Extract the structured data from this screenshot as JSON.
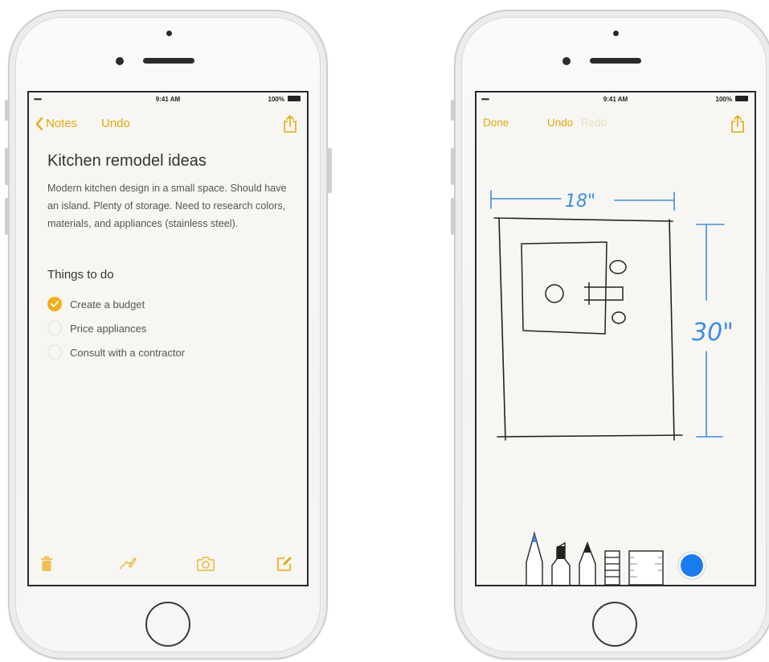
{
  "left_phone": {
    "status": {
      "signal": "•••••",
      "time": "9:41 AM",
      "battery": "100%"
    },
    "nav": {
      "back_label": "Notes",
      "undo_label": "Undo"
    },
    "note": {
      "title": "Kitchen remodel ideas",
      "body": "Modern kitchen design in a small space. Should have an island. Plenty of storage. Need to research colors, materials, and appliances (stainless steel).",
      "section_title": "Things to do",
      "checklist": [
        {
          "label": "Create a budget",
          "checked": true
        },
        {
          "label": "Price appliances",
          "checked": false
        },
        {
          "label": "Consult with a contractor",
          "checked": false
        }
      ]
    },
    "toolbar_icons": [
      "trash-icon",
      "sketch-icon",
      "camera-icon",
      "compose-icon"
    ]
  },
  "right_phone": {
    "status": {
      "signal": "•••••",
      "time": "9:41 AM",
      "battery": "100%"
    },
    "nav": {
      "done_label": "Done",
      "undo_label": "Undo",
      "redo_label": "Redo"
    },
    "sketch": {
      "width_label": "18\"",
      "height_label": "30\""
    },
    "tools": [
      "pen-tool-icon",
      "marker-tool-icon",
      "pencil-tool-icon",
      "eraser-tool-icon",
      "ruler-tool-icon",
      "color-picker-icon"
    ]
  },
  "colors": {
    "accent": "#e4a90c",
    "check_fill": "#f2ae14",
    "sketch_blue": "#3a8ee6",
    "ink": "#222222",
    "selected_color": "#1a7cf0"
  }
}
